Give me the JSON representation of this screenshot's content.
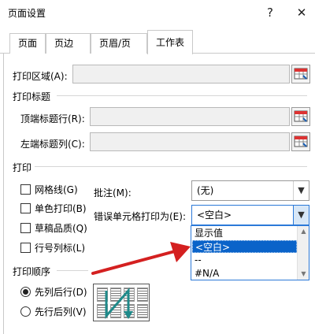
{
  "window": {
    "title": "页面设置",
    "help_label": "?",
    "close_label": "✕"
  },
  "tabs": [
    {
      "label": "页面"
    },
    {
      "label": "页边距"
    },
    {
      "label": "页眉/页脚"
    },
    {
      "label": "工作表",
      "active": true
    }
  ],
  "print_area": {
    "label": "打印区域(A):",
    "value": ""
  },
  "print_titles": {
    "section": "打印标题",
    "top_rows_label": "顶端标题行(R):",
    "top_rows_value": "",
    "left_cols_label": "左端标题列(C):",
    "left_cols_value": ""
  },
  "print": {
    "section": "打印",
    "gridlines": {
      "label": "网格线(G)",
      "checked": false
    },
    "mono": {
      "label": "单色打印(B)",
      "checked": false
    },
    "draft": {
      "label": "草稿品质(Q)",
      "checked": false
    },
    "headings": {
      "label": "行号列标(L)",
      "checked": false
    },
    "comments_label": "批注(M):",
    "comments_value": "(无)",
    "errors_label": "错误单元格打印为(E):",
    "errors_value": "<空白>",
    "errors_options": [
      "显示值",
      "<空白>",
      "--",
      "#N/A"
    ],
    "errors_selected_index": 1
  },
  "page_order": {
    "section": "打印顺序",
    "down_then_over": {
      "label": "先列后行(D)",
      "selected": true
    },
    "over_then_down": {
      "label": "先行后列(V)",
      "selected": false
    }
  },
  "colors": {
    "selection": "#0a63c9",
    "focus_border": "#2b79d8",
    "arrow": "#d42020",
    "preview_arrow": "#1f8a8a"
  },
  "icons": [
    "range-picker-icon",
    "checkbox-icon",
    "radio-icon",
    "chevron-down-icon",
    "red-arrow-annotation",
    "page-order-preview"
  ]
}
